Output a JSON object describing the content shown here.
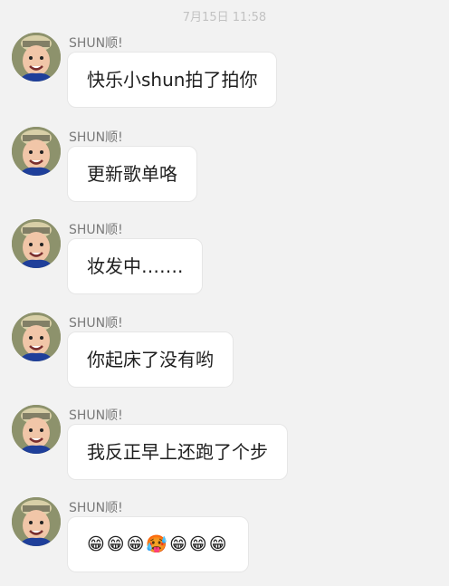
{
  "timestamp": "7月15日 11:58",
  "messages": [
    {
      "sender": "SHUN顺!",
      "text": "快乐小shun拍了拍你"
    },
    {
      "sender": "SHUN顺!",
      "text": "更新歌单咯"
    },
    {
      "sender": "SHUN顺!",
      "text": "妆发中……."
    },
    {
      "sender": "SHUN顺!",
      "text": "你起床了没有哟"
    },
    {
      "sender": "SHUN顺!",
      "text": "我反正早上还跑了个步"
    },
    {
      "sender": "SHUN顺!",
      "text": "😁😁😁🥵😁😁😁"
    }
  ],
  "colors": {
    "background": "#f2f2f2",
    "bubble": "#ffffff",
    "sender": "#7a7a7a",
    "timestamp": "#c2c2c2"
  }
}
